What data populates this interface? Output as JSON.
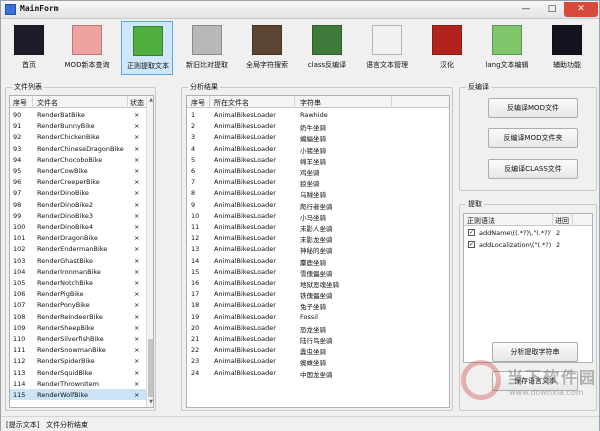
{
  "window": {
    "title": "MainForm",
    "min_label": "—",
    "max_label": "□",
    "close_label": "✕"
  },
  "toolbar": {
    "items": [
      {
        "label": "首页",
        "icon": "enderman-face-icon",
        "color": "#1e1c2b",
        "active": false
      },
      {
        "label": "MOD新本查询",
        "icon": "pig-face-icon",
        "color": "#efa3a0",
        "active": false
      },
      {
        "label": "正则提取文本",
        "icon": "creeper-face-icon",
        "color": "#4fae3d",
        "active": true
      },
      {
        "label": "新旧比对提取",
        "icon": "skeleton-face-icon",
        "color": "#b8b8b8",
        "active": false
      },
      {
        "label": "全局字符搜索",
        "icon": "cow-face-icon",
        "color": "#5b4431",
        "active": false
      },
      {
        "label": "class反编译",
        "icon": "zombie-face-icon",
        "color": "#3f7a3a",
        "active": false
      },
      {
        "label": "语言文本管理",
        "icon": "chicken-face-icon",
        "color": "#f1f1f1",
        "active": false
      },
      {
        "label": "汉化",
        "icon": "mooshroom-face-icon",
        "color": "#b3231d",
        "active": false
      },
      {
        "label": "lang文本编辑",
        "icon": "slime-face-icon",
        "color": "#7ec86b",
        "active": false
      },
      {
        "label": "辅助功能",
        "icon": "enderman-purple-face-icon",
        "color": "#151322",
        "active": false
      }
    ]
  },
  "file_list": {
    "group_title": "文件列表",
    "columns": [
      "序号",
      "文件名",
      "状态"
    ],
    "rows": [
      {
        "num": "90",
        "name": "RenderBatBike",
        "status": "×"
      },
      {
        "num": "91",
        "name": "RenderBunnyBike",
        "status": "×"
      },
      {
        "num": "92",
        "name": "RenderChickenBike",
        "status": "×"
      },
      {
        "num": "93",
        "name": "RenderChineseDragonBike",
        "status": "×"
      },
      {
        "num": "94",
        "name": "RenderChocoboBike",
        "status": "×"
      },
      {
        "num": "95",
        "name": "RenderCowBike",
        "status": "×"
      },
      {
        "num": "96",
        "name": "RenderCreeperBike",
        "status": "×"
      },
      {
        "num": "97",
        "name": "RenderDinoBike",
        "status": "×"
      },
      {
        "num": "98",
        "name": "RenderDinoBike2",
        "status": "×"
      },
      {
        "num": "99",
        "name": "RenderDinoBike3",
        "status": "×"
      },
      {
        "num": "100",
        "name": "RenderDinoBike4",
        "status": "×"
      },
      {
        "num": "101",
        "name": "RenderDragonBike",
        "status": "×"
      },
      {
        "num": "102",
        "name": "RenderEndermanBike",
        "status": "×"
      },
      {
        "num": "103",
        "name": "RenderGhastBike",
        "status": "×"
      },
      {
        "num": "104",
        "name": "RenderIronmanBike",
        "status": "×"
      },
      {
        "num": "105",
        "name": "RenderNotchBike",
        "status": "×"
      },
      {
        "num": "106",
        "name": "RenderPigBike",
        "status": "×"
      },
      {
        "num": "107",
        "name": "RenderPonyBike",
        "status": "×"
      },
      {
        "num": "108",
        "name": "RenderReindeerBike",
        "status": "×"
      },
      {
        "num": "109",
        "name": "RenderSheepBike",
        "status": "×"
      },
      {
        "num": "110",
        "name": "RenderSilverfishBike",
        "status": "×"
      },
      {
        "num": "111",
        "name": "RenderSnowmanBike",
        "status": "×"
      },
      {
        "num": "112",
        "name": "RenderSpiderBike",
        "status": "×"
      },
      {
        "num": "113",
        "name": "RenderSquidBike",
        "status": "×"
      },
      {
        "num": "114",
        "name": "RenderThrownItem",
        "status": "×"
      },
      {
        "num": "115",
        "name": "RenderWolfBike",
        "status": "×"
      }
    ],
    "selected_index": 25
  },
  "analysis": {
    "group_title": "分析结果",
    "columns": [
      "序号",
      "所在文件名",
      "字符串"
    ],
    "rows": [
      {
        "num": "1",
        "file": "AnimalBikesLoader",
        "text": "Rawhide"
      },
      {
        "num": "2",
        "file": "AnimalBikesLoader",
        "text": "奶牛坐骑"
      },
      {
        "num": "3",
        "file": "AnimalBikesLoader",
        "text": "蝙蝠坐骑"
      },
      {
        "num": "4",
        "file": "AnimalBikesLoader",
        "text": "小猪坐骑"
      },
      {
        "num": "5",
        "file": "AnimalBikesLoader",
        "text": "绵羊坐骑"
      },
      {
        "num": "6",
        "file": "AnimalBikesLoader",
        "text": "鸡坐骑"
      },
      {
        "num": "7",
        "file": "AnimalBikesLoader",
        "text": "狼坐骑"
      },
      {
        "num": "8",
        "file": "AnimalBikesLoader",
        "text": "乌贼坐骑"
      },
      {
        "num": "9",
        "file": "AnimalBikesLoader",
        "text": "爬行者坐骑"
      },
      {
        "num": "10",
        "file": "AnimalBikesLoader",
        "text": "小马坐骑"
      },
      {
        "num": "11",
        "file": "AnimalBikesLoader",
        "text": "末影人坐骑"
      },
      {
        "num": "12",
        "file": "AnimalBikesLoader",
        "text": "末影龙坐骑"
      },
      {
        "num": "13",
        "file": "AnimalBikesLoader",
        "text": "神秘的坐骑"
      },
      {
        "num": "14",
        "file": "AnimalBikesLoader",
        "text": "麋鹿坐骑"
      },
      {
        "num": "15",
        "file": "AnimalBikesLoader",
        "text": "雪傀儡坐骑"
      },
      {
        "num": "16",
        "file": "AnimalBikesLoader",
        "text": "地狱恶魂坐骑"
      },
      {
        "num": "17",
        "file": "AnimalBikesLoader",
        "text": "铁傀儡坐骑"
      },
      {
        "num": "18",
        "file": "AnimalBikesLoader",
        "text": "兔子坐骑"
      },
      {
        "num": "19",
        "file": "AnimalBikesLoader",
        "text": "Fossil"
      },
      {
        "num": "20",
        "file": "AnimalBikesLoader",
        "text": "恐龙坐骑"
      },
      {
        "num": "21",
        "file": "AnimalBikesLoader",
        "text": "陆行鸟坐骑"
      },
      {
        "num": "22",
        "file": "AnimalBikesLoader",
        "text": "蠹虫坐骑"
      },
      {
        "num": "23",
        "file": "AnimalBikesLoader",
        "text": "蜘蛛坐骑"
      },
      {
        "num": "24",
        "file": "AnimalBikesLoader",
        "text": "中国龙坐骑"
      }
    ]
  },
  "decompile": {
    "group_title": "反编译",
    "buttons": [
      "反编译MOD文件",
      "反编译MOD文件夹",
      "反编译CLASS文件"
    ]
  },
  "extract": {
    "group_title": "提取",
    "columns": [
      "正则语法",
      "",
      "进回"
    ],
    "rows": [
      {
        "checked": true,
        "pattern": "addName\\((.*?)\\,\"(.*?)\"\\)",
        "group": "2"
      },
      {
        "checked": true,
        "pattern": "addLocalization\\(\"(.*?)\",...",
        "group": "2"
      }
    ],
    "analyze_button": "分析提取字符串",
    "save_button": "保存语言文本"
  },
  "status_bar": {
    "label": "[提示文本]",
    "message": "文件分析结束"
  },
  "watermark": {
    "brand": "当下软件园",
    "url": "www.downxia.com"
  }
}
